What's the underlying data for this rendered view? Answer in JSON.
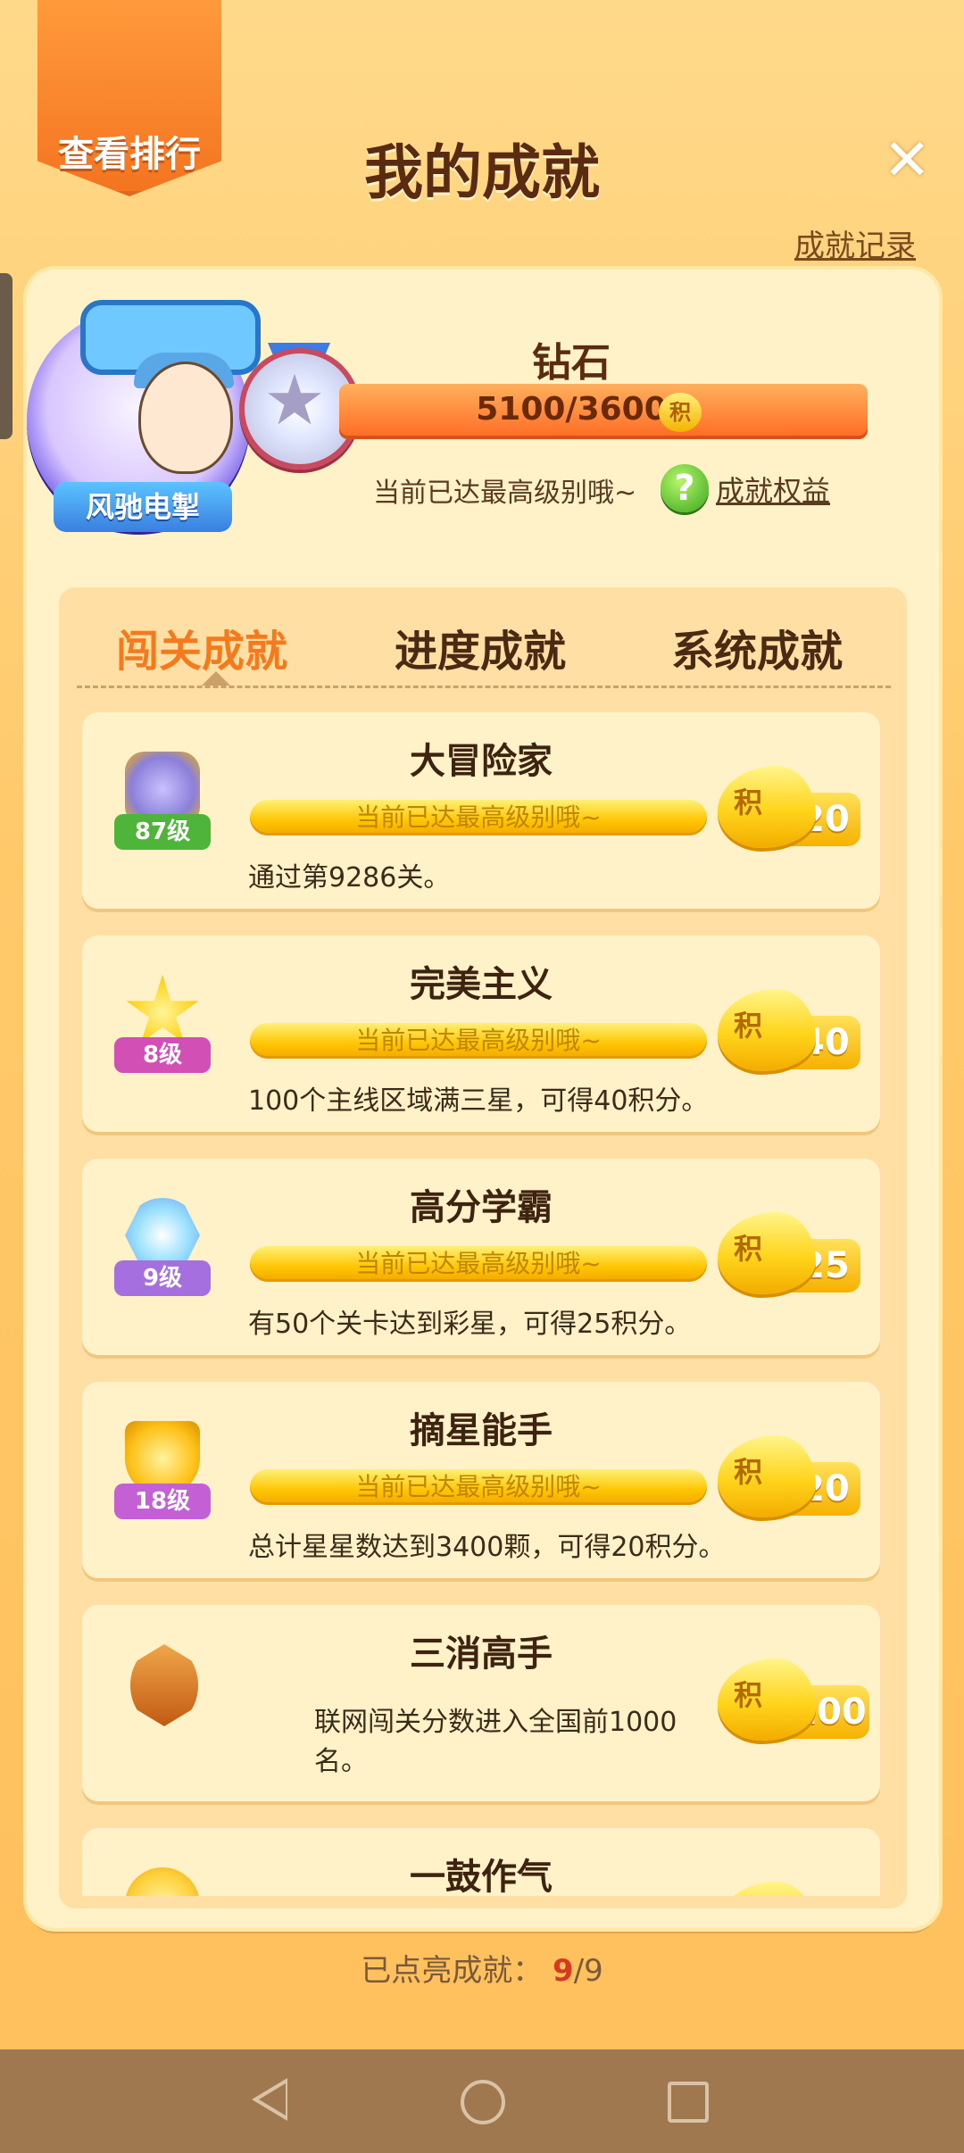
{
  "header": {
    "rank_button": "查看排行",
    "title": "我的成就",
    "close_symbol": "✕",
    "record_link": "成就记录"
  },
  "profile": {
    "avatar_name": "风驰电掣",
    "level_name": "钻石",
    "score_text": "5100/3600",
    "coin_label": "积",
    "status": "当前已达最高级别哦~",
    "help_symbol": "?",
    "rights_link": "成就权益"
  },
  "tabs": [
    {
      "label": "闯关成就",
      "active": true
    },
    {
      "label": "进度成就",
      "active": false
    },
    {
      "label": "系统成就",
      "active": false
    }
  ],
  "achievements": [
    {
      "title": "大冒险家",
      "bar": "当前已达最高级别哦~",
      "desc": "通过第9286关。",
      "level": "87级",
      "coin_label": "积",
      "points": "20",
      "badge_color": "#8b7fd9",
      "level_color": "#4fb43a"
    },
    {
      "title": "完美主义",
      "bar": "当前已达最高级别哦~",
      "desc": "100个主线区域满三星，可得40积分。",
      "level": "8级",
      "coin_label": "积",
      "points": "40",
      "badge_color": "#ffd21a",
      "level_color": "#d24fb5"
    },
    {
      "title": "高分学霸",
      "bar": "当前已达最高级别哦~",
      "desc": "有50个关卡达到彩星，可得25积分。",
      "level": "9级",
      "coin_label": "积",
      "points": "25",
      "badge_color": "#9ae0ff",
      "level_color": "#a56fe0"
    },
    {
      "title": "摘星能手",
      "bar": "当前已达最高级别哦~",
      "desc": "总计星星数达到3400颗，可得20积分。",
      "level": "18级",
      "coin_label": "积",
      "points": "20",
      "badge_color": "#ffc21a",
      "level_color": "#c45fd6"
    },
    {
      "title": "三消高手",
      "bar": "",
      "desc": "联网闯关分数进入全国前1000名。",
      "level": "",
      "coin_label": "积",
      "points": "100",
      "badge_color": "#e2862d",
      "level_color": ""
    },
    {
      "title": "一鼓作气",
      "bar": "",
      "desc": "",
      "level": "",
      "coin_label": "积",
      "points": "",
      "badge_color": "#ffcf3a",
      "level_color": ""
    }
  ],
  "footer": {
    "label": "已点亮成就：",
    "current": "9",
    "separator": "/",
    "total": "9"
  },
  "colors": {
    "accent": "#f47a1d",
    "title_text": "#5a2b10",
    "bar_yellow": "#ffc400",
    "highlight_red": "#d83820"
  }
}
